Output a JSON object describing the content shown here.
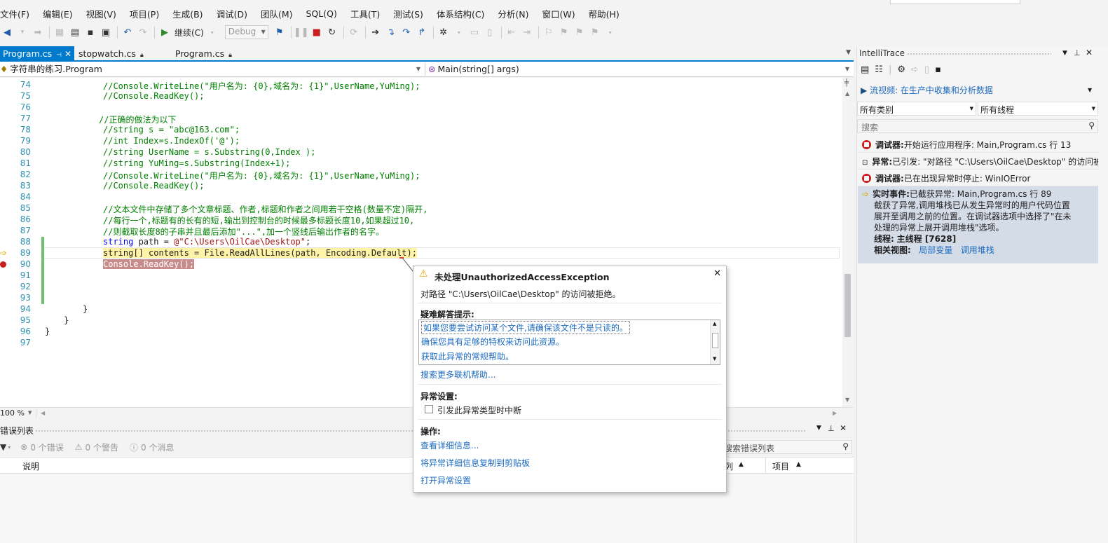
{
  "menu": [
    "文件(F)",
    "编辑(E)",
    "视图(V)",
    "项目(P)",
    "生成(B)",
    "调试(D)",
    "团队(M)",
    "SQL(Q)",
    "工具(T)",
    "测试(S)",
    "体系结构(C)",
    "分析(N)",
    "窗口(W)",
    "帮助(H)"
  ],
  "toolbar": {
    "continue_label": "继续(C)",
    "config": "Debug"
  },
  "tabs": [
    {
      "label": "Program.cs",
      "active": true
    },
    {
      "label": "stopwatch.cs",
      "active": false
    },
    {
      "label": "Program.cs",
      "active": false
    }
  ],
  "nav": {
    "class": "字符串的练习.Program",
    "method": "Main(string[] args)"
  },
  "code": {
    "lines": [
      {
        "n": "74",
        "text": "//Console.WriteLine(\"用户名为: {0},域名为: {1}\",UserName,YuMing);",
        "type": "comment"
      },
      {
        "n": "75",
        "text": "//Console.ReadKey();",
        "type": "comment"
      },
      {
        "n": "76",
        "text": "",
        "type": "plain"
      },
      {
        "n": "77",
        "text": "//正确的做法为以下",
        "type": "comment"
      },
      {
        "n": "78",
        "text": "//string s = \"abc@163.com\";",
        "type": "comment"
      },
      {
        "n": "79",
        "text": "//int Index=s.IndexOf('@');",
        "type": "comment"
      },
      {
        "n": "80",
        "text": "//string UserName = s.Substring(0,Index );",
        "type": "comment"
      },
      {
        "n": "81",
        "text": "//string YuMing=s.Substring(Index+1);",
        "type": "comment"
      },
      {
        "n": "82",
        "text": "//Console.WriteLine(\"用户名为: {0},域名为: {1}\",UserName,YuMing);",
        "type": "comment"
      },
      {
        "n": "83",
        "text": "//Console.ReadKey();",
        "type": "comment"
      },
      {
        "n": "84",
        "text": "",
        "type": "plain"
      },
      {
        "n": "85",
        "text": "//文本文件中存储了多个文章标题、作者,标题和作者之间用若干空格(数量不定)隔开,",
        "type": "comment"
      },
      {
        "n": "86",
        "text": "//每行一个,标题有的长有的短,输出到控制台的时候最多标题长度10,如果超过10,",
        "type": "comment"
      },
      {
        "n": "87",
        "text": "//则截取长度8的子串并且最后添加\"...\",加一个竖线后输出作者的名字。",
        "type": "comment"
      },
      {
        "n": "88",
        "text": "string path = @\"C:\\Users\\OilCae\\Desktop\";",
        "type": "path"
      },
      {
        "n": "89",
        "text": "string[] contents = File.ReadAllLines(path, Encoding.Default);",
        "type": "current"
      },
      {
        "n": "90",
        "text": "Console.ReadKey();",
        "type": "breakpoint"
      },
      {
        "n": "91",
        "text": "",
        "type": "plain"
      },
      {
        "n": "92",
        "text": "",
        "type": "plain"
      },
      {
        "n": "93",
        "text": "",
        "type": "plain"
      },
      {
        "n": "94",
        "text": "}",
        "type": "brace"
      },
      {
        "n": "95",
        "text": "}",
        "type": "brace"
      },
      {
        "n": "96",
        "text": "}",
        "type": "brace"
      },
      {
        "n": "97",
        "text": "",
        "type": "plain"
      }
    ],
    "tokens": {
      "kw_string": "string",
      "path_rest": " path = ",
      "path_str": "@\"C:\\Users\\OilCae\\Desktop\"",
      "semi": ";"
    }
  },
  "zoom": "100 %",
  "error_list": {
    "title": "错误列表",
    "errors": "0 个错误",
    "warnings": "0 个警告",
    "messages": "0 个消息",
    "search_placeholder": "搜索错误列表",
    "col_desc": "说明",
    "col_col": "列",
    "col_project": "项目"
  },
  "intellitrace": {
    "title": "IntelliTrace",
    "video_link": "流视频: 在生产中收集和分析数据",
    "category": "所有类别",
    "thread": "所有线程",
    "search_placeholder": "搜索",
    "events": [
      {
        "kind": "调试器:",
        "text": "开始运行应用程序: Main,Program.cs 行 13"
      },
      {
        "kind": "异常:",
        "text": "已引发: \"对路径 \"C:\\Users\\OilCae\\Desktop\" 的访问被拒绝。"
      },
      {
        "kind": "调试器:",
        "text": "已在出现异常时停止: WinIOError"
      }
    ],
    "live": {
      "kind": "实时事件:",
      "text": "已截获异常: Main,Program.cs 行 89",
      "desc1": "截获了异常,调用堆栈已从发生异常时的用户代码位置",
      "desc2": "展开至调用之前的位置。在调试器选项中选择了\"在未",
      "desc3": "处理的异常上展开调用堆栈\"选项。",
      "thread_label": "线程:",
      "thread_val": "主线程 [7628]",
      "related_label": "相关视图:",
      "locals": "局部变量",
      "callstack": "调用堆栈"
    }
  },
  "exception": {
    "title": "未处理UnauthorizedAccessException",
    "message": "对路径 \"C:\\Users\\OilCae\\Desktop\" 的访问被拒绝。",
    "hints_heading": "疑难解答提示:",
    "hints": [
      "如果您要尝试访问某个文件,请确保该文件不是只读的。",
      "确保您具有足够的特权来访问此资源。",
      "获取此异常的常规帮助。"
    ],
    "search_more": "搜索更多联机帮助...",
    "settings_heading": "异常设置:",
    "break_checkbox": "引发此异常类型时中断",
    "break_checked": false,
    "actions_heading": "操作:",
    "actions": [
      "查看详细信息...",
      "将异常详细信息复制到剪贴板",
      "打开异常设置"
    ]
  }
}
